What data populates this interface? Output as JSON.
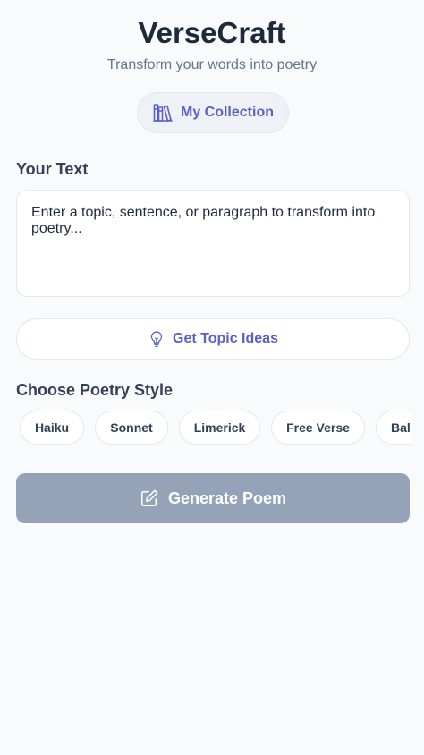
{
  "app": {
    "title": "VerseCraft",
    "subtitle": "Transform your words into poetry"
  },
  "collection_button": {
    "label": "My Collection",
    "icon": "books-icon"
  },
  "text_section": {
    "label": "Your Text",
    "placeholder": "Enter a topic, sentence, or paragraph to transform into poetry...",
    "value": ""
  },
  "topic_ideas_button": {
    "label": "Get Topic Ideas",
    "icon": "lightbulb-icon"
  },
  "style_section": {
    "label": "Choose Poetry Style",
    "styles": [
      "Haiku",
      "Sonnet",
      "Limerick",
      "Free Verse",
      "Bal"
    ]
  },
  "generate_button": {
    "label": "Generate Poem",
    "icon": "edit-icon",
    "enabled": false
  },
  "colors": {
    "accent": "#5b5fc7",
    "background": "#f8fafc",
    "disabled_button": "#94a3b8",
    "heading": "#1e293b",
    "muted": "#64748b"
  }
}
